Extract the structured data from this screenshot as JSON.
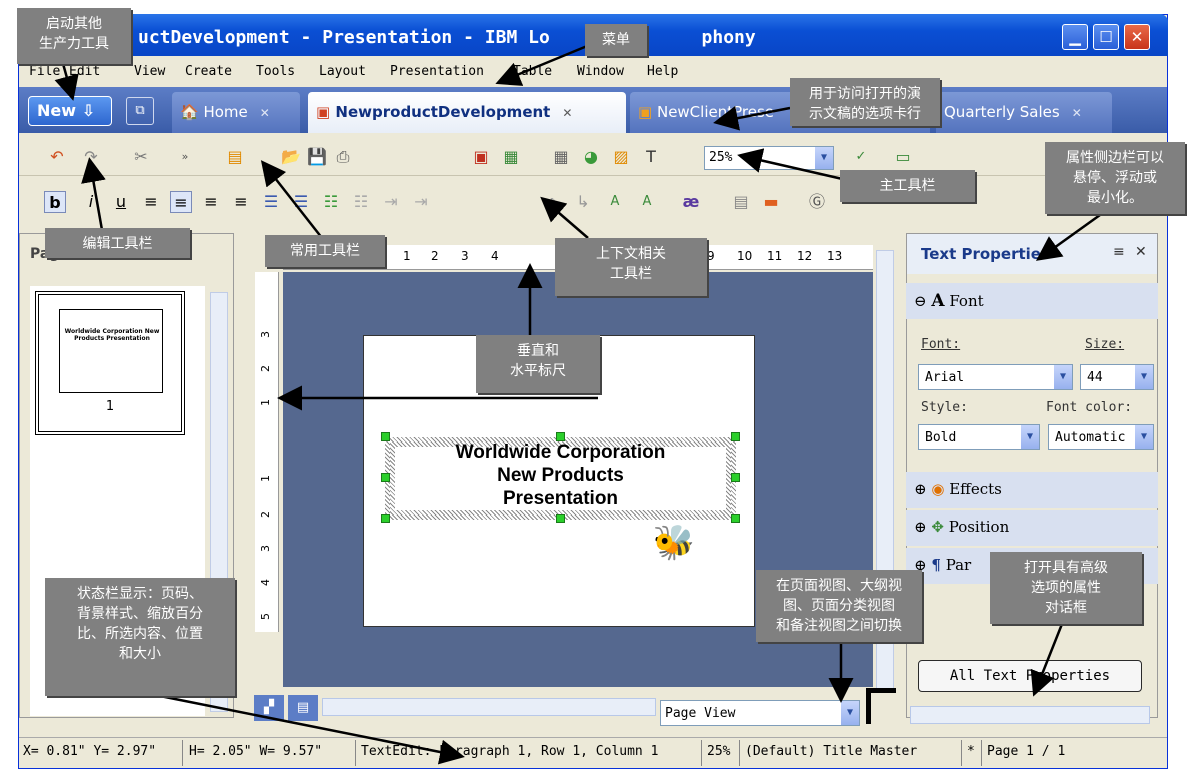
{
  "window": {
    "title": "uctDevelopment - Presentation - IBM Lo",
    "title_tail": "phony"
  },
  "menu": [
    "File",
    "Edit",
    "View",
    "Create",
    "Tools",
    "Layout",
    "Presentation",
    "Table",
    "Window",
    "Help"
  ],
  "new_button": "New",
  "tabs": [
    {
      "label": "Home",
      "active": false
    },
    {
      "label": "NewproductDevelopment",
      "active": true
    },
    {
      "label": "NewClientPrese",
      "active": false
    },
    {
      "label": "Quarterly Sales",
      "active": false
    }
  ],
  "toolbar": {
    "zoom": "25%"
  },
  "thumbnails": {
    "title": "Page Thumbnails",
    "page_number": "1",
    "mini_text": "Worldwide Corporation New Products Presentation"
  },
  "ruler": {
    "h_numbers": [
      "1",
      "2",
      "3",
      "4",
      "9",
      "10",
      "11",
      "12",
      "13"
    ],
    "v_numbers": [
      "3",
      "2",
      "1",
      "1",
      "2",
      "3",
      "4",
      "5"
    ]
  },
  "slide": {
    "line1": "Worldwide Corporation",
    "line2": "New Products",
    "line3": "Presentation"
  },
  "properties": {
    "title": "Text Properties",
    "font_section": "Font",
    "font_label": "Font:",
    "size_label": "Size:",
    "font_value": "Arial",
    "size_value": "44",
    "style_label": "Style:",
    "color_label": "Font color:",
    "style_value": "Bold",
    "color_value": "Automatic",
    "effects": "Effects",
    "position": "Position",
    "paragraph": "Par",
    "all_button": "All Text Properties"
  },
  "view_select": "Page View",
  "status": {
    "xy": "X= 0.81\" Y= 2.97\"",
    "hw": "H= 2.05\" W= 9.57\"",
    "edit": "TextEdit: Paragraph 1, Row 1, Column 1",
    "zoom": "25%",
    "master": "(Default) Title Master",
    "star": "*",
    "page": "Page 1 / 1"
  },
  "callouts": {
    "other_apps": "启动其他\n生产力工具",
    "menu": "菜单",
    "tabs_row": "用于访问打开的演\n示文稿的选项卡行",
    "sidebar_note": "属性侧边栏可以\n悬停、浮动或\n最小化。",
    "main_toolbar": "主工具栏",
    "edit_toolbar": "编辑工具栏",
    "common_toolbar": "常用工具栏",
    "context_toolbar": "上下文相关\n工具栏",
    "rulers": "垂直和\n水平标尺",
    "status_note": "状态栏显示：页码、\n背景样式、缩放百分\n比、所选内容、位置\n和大小",
    "view_switch": "在页面视图、大纲视\n图、页面分类视图\n和备注视图之间切换",
    "props_dialog": "打开具有高级\n选项的属性\n对话框"
  },
  "colors": {
    "titlebar": "#0A4FD4",
    "tabbar": "#4A6CB8",
    "slide_bg": "#55688F",
    "handle": "#2BCF2B",
    "callout": "#808080"
  }
}
